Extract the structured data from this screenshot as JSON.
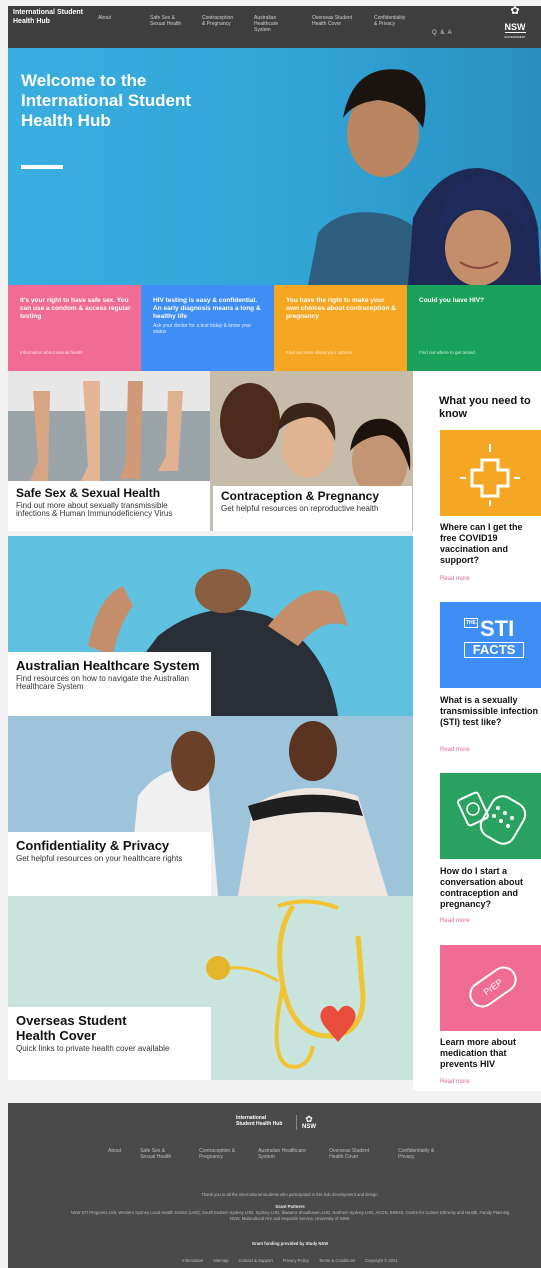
{
  "header": {
    "site_name": "International Student Health Hub",
    "nav": [
      "About",
      "Safe Sex & Sexual Health",
      "Contraception & Pregnancy",
      "Australian Healthcare System",
      "Overseas Student Health Cover",
      "Confidentiality & Privacy"
    ],
    "qa": "Q & A",
    "gov_logo": {
      "waratah": "✿",
      "text": "NSW",
      "sub": "GOVERNMENT"
    }
  },
  "hero": {
    "title": "Welcome to the International Student Health Hub"
  },
  "tiles": [
    {
      "heading": "It's your right to have safe sex. You can use a condom & access regular testing",
      "sub": "",
      "link": "Information about sexual health",
      "color": "#f06c95"
    },
    {
      "heading": "HIV testing is easy & confidential. An early diagnosis means a long & healthy life",
      "sub": "Ask your doctor for a test today & know your status",
      "link": "",
      "color": "#3f8ef5"
    },
    {
      "heading": "You have the right to make your own choices about contraception & pregnancy",
      "sub": "",
      "link": "Find out more about your options",
      "color": "#f5a623"
    },
    {
      "heading": "Could you have HIV?",
      "sub": "",
      "link": "Find out where to get tested",
      "color": "#1aa25a"
    }
  ],
  "cards": [
    {
      "title": "Safe Sex & Sexual Health",
      "desc": "Find out more about sexually transmissible infections & Human Immunodeficiency Virus"
    },
    {
      "title": "Contraception & Pregnancy",
      "desc": "Get helpful resources on reproductive health"
    },
    {
      "title": "Australian Healthcare System",
      "desc": "Find resources on how to navigate the Australian Healthcare System"
    },
    {
      "title": "Confidentiality & Privacy",
      "desc": "Get helpful resources on your healthcare rights"
    },
    {
      "title": "Overseas Student Health Cover",
      "desc": "Quick links to private health cover available"
    }
  ],
  "sidebar": {
    "heading": "What you need to know",
    "items": [
      {
        "question": "Where can I get the free COVID19 vaccination and support?",
        "read_more": "Read more",
        "color": "#f5a623",
        "icon": "covid-cross-icon"
      },
      {
        "question": "What is a sexually transmissible infection (STI) test like?",
        "read_more": "Read more",
        "color": "#3f8ef5",
        "icon": "sti-facts-icon",
        "badge_top": "THE",
        "badge_main": "STI",
        "badge_bottom": "FACTS"
      },
      {
        "question": "How do I start a conversation about contraception and pregnancy?",
        "read_more": "Read more",
        "color": "#2aa360",
        "icon": "contraceptive-icon"
      },
      {
        "question": "Learn more about medication that prevents HIV",
        "read_more": "Read more",
        "color": "#f06c95",
        "icon": "prep-pill-icon",
        "pill_label": "PrEP"
      }
    ]
  },
  "footer": {
    "site_name": "International Student Health Hub",
    "nav": [
      "About",
      "Safe Sex & Sexual Health",
      "Contraception & Pregnancy",
      "Australian Healthcare System",
      "Overseas Student Health Cover",
      "Confidentiality & Privacy"
    ],
    "thanks": "Thank you to all the international students who participated in this hub development and design.",
    "grant_heading": "Grant Partners",
    "grant_text": "NSW STI Programs Unit, Western Sydney Local Health District (LHD), South Eastern Sydney LHD, Sydney LHD, Illawarra Shoalhaven LHD, Northern Sydney LHD, ACON, BIMHS, Centre for Culture Ethnicity and Health, Family Planning NSW, Multicultural HIV and Hepatitis Service, University of NSW.",
    "funding": "Grant funding provided by Study NSW",
    "links": [
      "Information",
      "Sitemap",
      "Contact & Support",
      "Privacy Policy",
      "Terms & Conditions",
      "Copyright © 2021"
    ]
  }
}
